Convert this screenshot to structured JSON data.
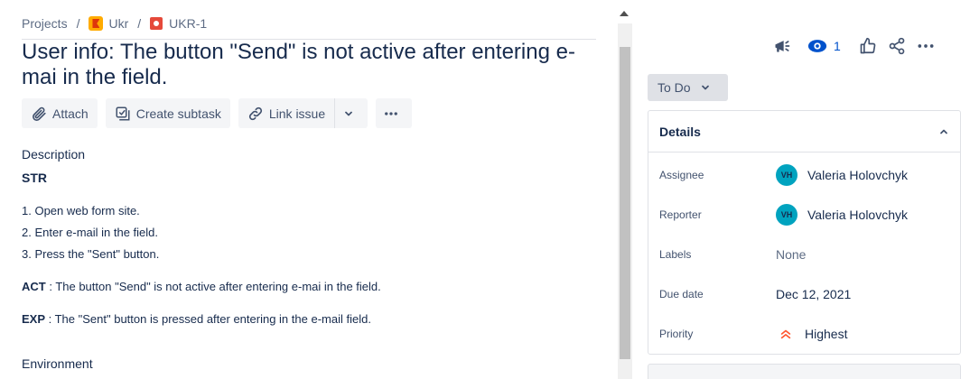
{
  "breadcrumb": {
    "projects": "Projects",
    "separator": "/",
    "project": "Ukr",
    "issue_key": "UKR-1"
  },
  "issue": {
    "title": "User info: The button \"Send\" is not active after entering e-mai in the field."
  },
  "actions": {
    "attach": "Attach",
    "create_subtask": "Create subtask",
    "link_issue": "Link issue"
  },
  "description": {
    "label": "Description",
    "str_heading": "STR",
    "steps": [
      "1. Open web form site.",
      "2. Enter e-mail in the field.",
      "3. Press the \"Sent\" button."
    ],
    "act_label": "ACT",
    "act_text": " : The button \"Send\" is not active after entering e-mai in the field.",
    "exp_label": "EXP",
    "exp_text": " : The \"Sent\" button is pressed after entering in the e-mail field."
  },
  "environment": {
    "label": "Environment"
  },
  "sidebar": {
    "watchers_count": "1",
    "status": "To Do",
    "details": {
      "heading": "Details",
      "assignee_label": "Assignee",
      "assignee_initials": "VH",
      "assignee_name": "Valeria Holovchyk",
      "reporter_label": "Reporter",
      "reporter_initials": "VH",
      "reporter_name": "Valeria Holovchyk",
      "labels_label": "Labels",
      "labels_value": "None",
      "due_label": "Due date",
      "due_value": "Dec 12, 2021",
      "priority_label": "Priority",
      "priority_value": "Highest"
    }
  },
  "colors": {
    "text": "#172b4d",
    "accent": "#0052cc",
    "priority_highest": "#ff5630",
    "avatar": "#00a3bf"
  }
}
